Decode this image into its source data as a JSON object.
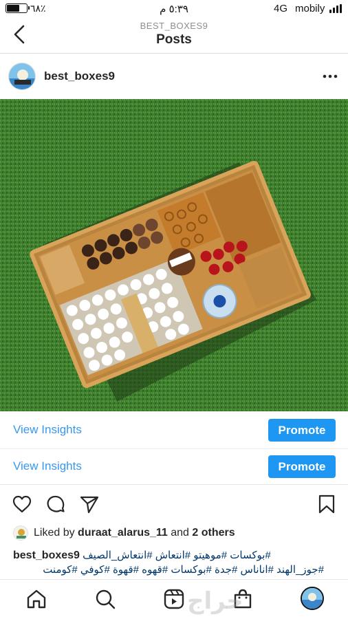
{
  "status_bar": {
    "battery_percent": "٦٨٪",
    "time": "٥:٣٩ م",
    "network": "4G",
    "carrier": "mobily"
  },
  "nav": {
    "account": "BEST_BOXES9",
    "title": "Posts"
  },
  "post": {
    "username": "best_boxes9",
    "insights": [
      {
        "link": "View Insights",
        "button": "Promote"
      },
      {
        "link": "View Insights",
        "button": "Promote"
      }
    ],
    "likes": {
      "prefix": "Liked by",
      "user": "duraat_alarus_11",
      "conjunction": "and",
      "others": "2 others"
    },
    "caption": {
      "username": "best_boxes9",
      "line1": "#بوكسات #موهيتو #انتعاش #انتعاش_الصيف",
      "line2": "#جوز_الهند #اناناس #جدة #بوكسات #قهوه #قهوة #كوفي #كومنت"
    }
  },
  "watermark": "حراج",
  "colors": {
    "link_blue": "#3897f0",
    "promote_blue": "#1e97f2",
    "grass_green": "#3d7a2c",
    "hashtag": "#00376b"
  }
}
